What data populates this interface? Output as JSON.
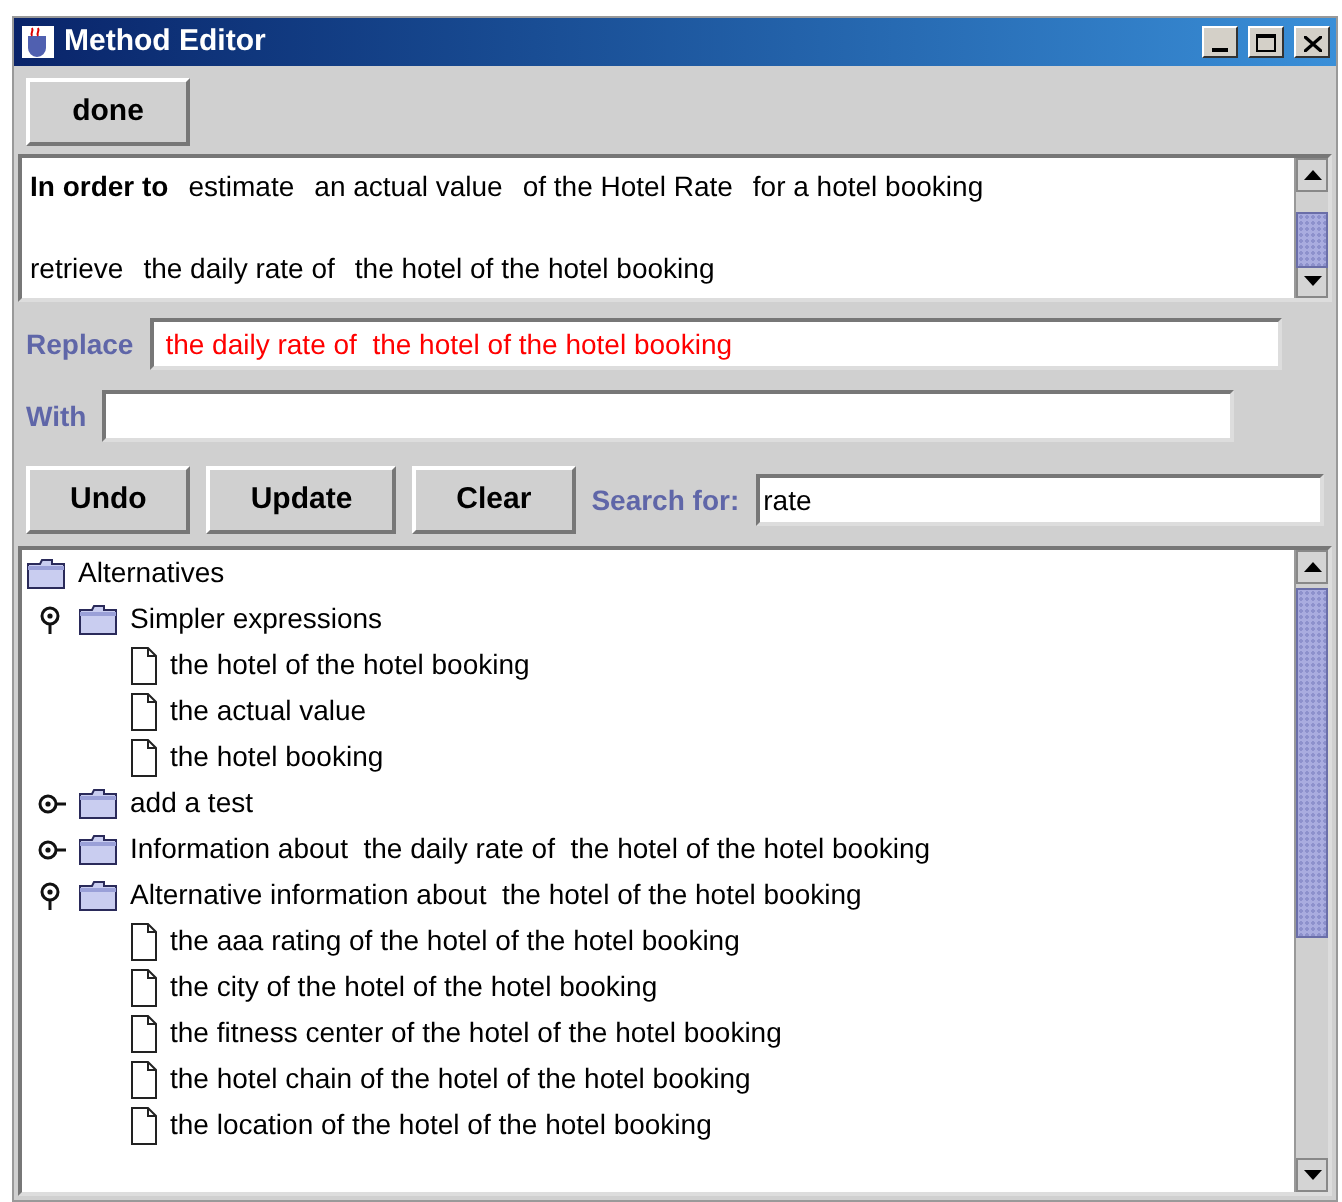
{
  "window": {
    "title": "Method Editor"
  },
  "done_button": "done",
  "statement": {
    "lines": [
      {
        "lead": "In order to",
        "phrases": [
          "estimate",
          "an actual value",
          "of the Hotel Rate",
          "for a hotel booking"
        ]
      },
      {
        "phrases": [
          "retrieve",
          "the daily rate of",
          "the hotel of the hotel booking"
        ]
      }
    ]
  },
  "replace": {
    "label": "Replace",
    "value": "the daily rate of  the hotel of the hotel booking"
  },
  "with": {
    "label": "With"
  },
  "buttons": [
    "Undo",
    "Update",
    "Clear"
  ],
  "search": {
    "label": "Search for:",
    "value": "rate"
  },
  "tree": {
    "label": "Alternatives",
    "kind": "folder",
    "children": [
      {
        "label": "Simpler expressions",
        "kind": "folder",
        "expanded": true,
        "children": [
          {
            "label": "the hotel of the hotel booking",
            "kind": "leaf"
          },
          {
            "label": "the actual value",
            "kind": "leaf"
          },
          {
            "label": "the hotel booking",
            "kind": "leaf"
          }
        ]
      },
      {
        "label": "add a test",
        "kind": "folder",
        "expanded": false
      },
      {
        "label": "Information about  the daily rate of  the hotel of the hotel booking",
        "kind": "folder",
        "expanded": false
      },
      {
        "label": "Alternative information about  the hotel of the hotel booking",
        "kind": "folder",
        "expanded": true,
        "children": [
          {
            "label": "the aaa rating of the hotel of the hotel booking",
            "kind": "leaf"
          },
          {
            "label": "the city of the hotel of the hotel booking",
            "kind": "leaf"
          },
          {
            "label": "the fitness center of the hotel of the hotel booking",
            "kind": "leaf"
          },
          {
            "label": "the hotel chain of the hotel of the hotel booking",
            "kind": "leaf"
          },
          {
            "label": "the location of the hotel of the hotel booking",
            "kind": "leaf"
          }
        ]
      }
    ]
  }
}
